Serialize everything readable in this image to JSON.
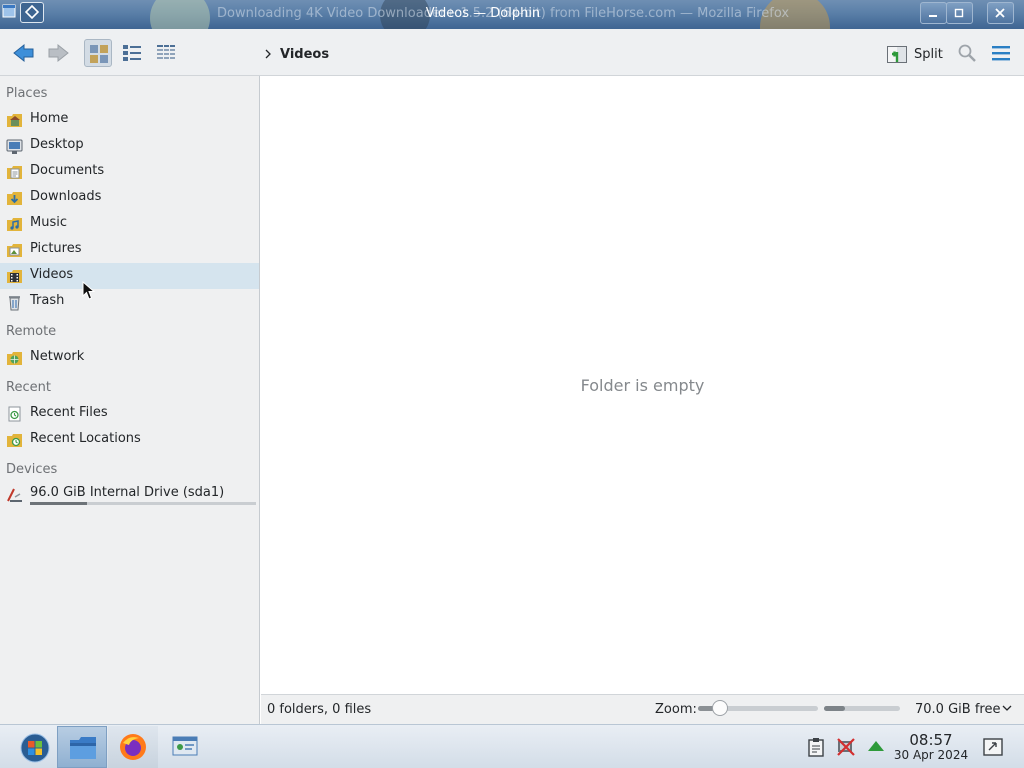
{
  "window": {
    "title": "Videos — Dolphin",
    "background_title": "Downloading 4K Video Downloader+ 1.5.2 (64-bit) from FileHorse.com — Mozilla Firefox"
  },
  "toolbar": {
    "back_icon": "back-arrow-icon",
    "forward_icon": "forward-arrow-icon",
    "views": [
      "icons-view-icon",
      "compact-view-icon",
      "details-view-icon"
    ],
    "breadcrumb": [
      "Videos"
    ],
    "split_label": "Split",
    "search_icon": "search-icon",
    "menu_icon": "hamburger-menu-icon"
  },
  "sidebar": {
    "sections": {
      "places": "Places",
      "remote": "Remote",
      "recent": "Recent",
      "devices": "Devices"
    },
    "places": [
      {
        "label": "Home",
        "icon": "home-folder-icon"
      },
      {
        "label": "Desktop",
        "icon": "desktop-folder-icon"
      },
      {
        "label": "Documents",
        "icon": "documents-folder-icon"
      },
      {
        "label": "Downloads",
        "icon": "downloads-folder-icon"
      },
      {
        "label": "Music",
        "icon": "music-folder-icon"
      },
      {
        "label": "Pictures",
        "icon": "pictures-folder-icon"
      },
      {
        "label": "Videos",
        "icon": "videos-folder-icon",
        "selected": true
      },
      {
        "label": "Trash",
        "icon": "trash-icon"
      }
    ],
    "remote": [
      {
        "label": "Network",
        "icon": "network-folder-icon"
      }
    ],
    "recent": [
      {
        "label": "Recent Files",
        "icon": "recent-files-icon"
      },
      {
        "label": "Recent Locations",
        "icon": "recent-locations-icon"
      }
    ],
    "devices": [
      {
        "label": "96.0 GiB Internal Drive (sda1)",
        "icon": "hard-drive-icon",
        "usage_fraction": 0.25
      }
    ]
  },
  "main": {
    "empty_message": "Folder is empty"
  },
  "statusbar": {
    "summary": "0 folders, 0 files",
    "zoom_label": "Zoom:",
    "zoom_fraction": 0.18,
    "space_used_fraction": 0.27,
    "free_space": "70.0 GiB free"
  },
  "taskbar": {
    "start_icon": "start-menu-orb-icon",
    "tasks": [
      "dolphin-file-manager-icon",
      "firefox-icon",
      "system-settings-icon"
    ],
    "tray": [
      "clipboard-icon",
      "network-disconnected-icon",
      "updates-icon"
    ],
    "clock_time": "08:57",
    "clock_date": "30 Apr 2024"
  },
  "colors": {
    "selection": "#d5e4ee",
    "sidebar_bg": "#eff0f1",
    "titlebar": "#4a6f9b",
    "accent": "#3daee9",
    "folder": "#f5c211"
  }
}
